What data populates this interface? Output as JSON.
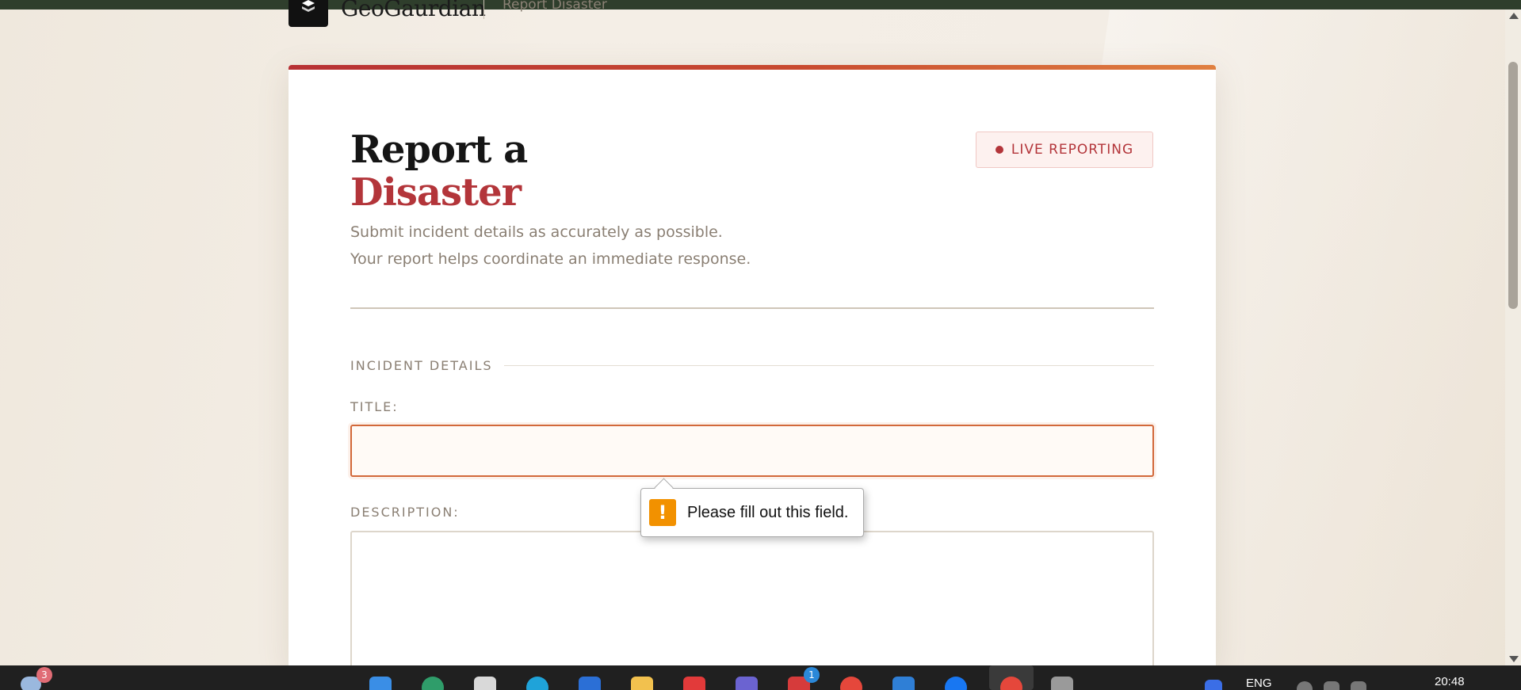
{
  "nav": {
    "brand": "GeoGaurdian",
    "breadcrumb": "Report Disaster"
  },
  "card": {
    "title_line1": "Report a",
    "title_line2": "Disaster",
    "badge": "LIVE REPORTING",
    "subtitle_line1": "Submit incident details as accurately as possible.",
    "subtitle_line2": "Your report helps coordinate an immediate response.",
    "section_label": "INCIDENT DETAILS",
    "title_label": "TITLE:",
    "title_value": "",
    "description_label": "DESCRIPTION:",
    "description_value": ""
  },
  "validation": {
    "icon_glyph": "!",
    "message": "Please fill out this field."
  },
  "taskbar": {
    "weather_badge": "3",
    "app_badge": "1",
    "language": "ENG",
    "time": "20:48"
  },
  "colors": {
    "accent_red": "#b3353a",
    "focus_orange": "#d2683a",
    "warning_orange": "#f29100"
  }
}
